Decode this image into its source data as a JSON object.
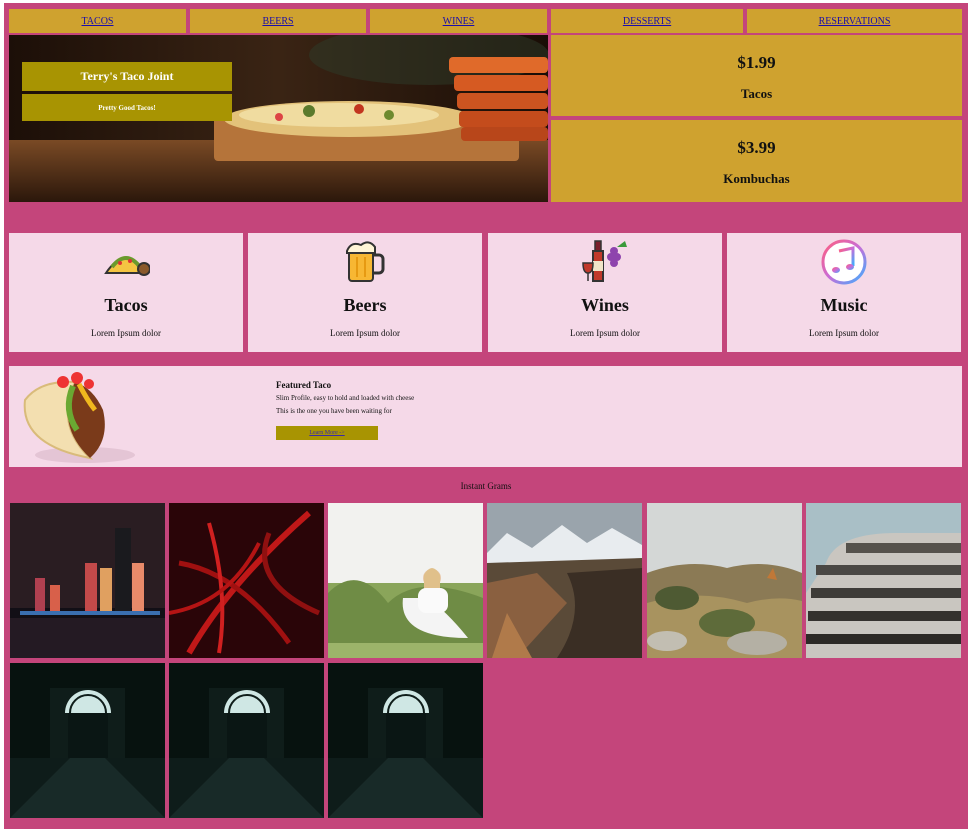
{
  "nav": [
    {
      "label": "TACOS"
    },
    {
      "label": "BEERS"
    },
    {
      "label": "WINES"
    },
    {
      "label": "DESSERTS"
    },
    {
      "label": "RESERVATIONS"
    }
  ],
  "hero": {
    "title": "Terry's Taco Joint",
    "subtitle": "Pretty Good Tacos!"
  },
  "prices": [
    {
      "amount": "$1.99",
      "item": "Tacos"
    },
    {
      "amount": "$3.99",
      "item": "Kombuchas"
    }
  ],
  "cards": [
    {
      "title": "Tacos",
      "desc": "Lorem Ipsum dolor",
      "icon": "taco-icon"
    },
    {
      "title": "Beers",
      "desc": "Lorem Ipsum dolor",
      "icon": "beer-mug-icon"
    },
    {
      "title": "Wines",
      "desc": "Lorem Ipsum dolor",
      "icon": "wine-grapes-icon"
    },
    {
      "title": "Music",
      "desc": "Lorem Ipsum dolor",
      "icon": "music-note-icon"
    }
  ],
  "featured": {
    "heading": "Featured Taco",
    "line1": "Slim Profile, easy to hold and loaded with cheese",
    "line2": "This is the one you have been waiting for",
    "button": "Learn More ->"
  },
  "grams": {
    "label": "Instant Grams"
  },
  "colors": {
    "page": "#c4457b",
    "gold": "#cfa22f",
    "olive": "#a89402",
    "card": "#f5d9e8"
  }
}
